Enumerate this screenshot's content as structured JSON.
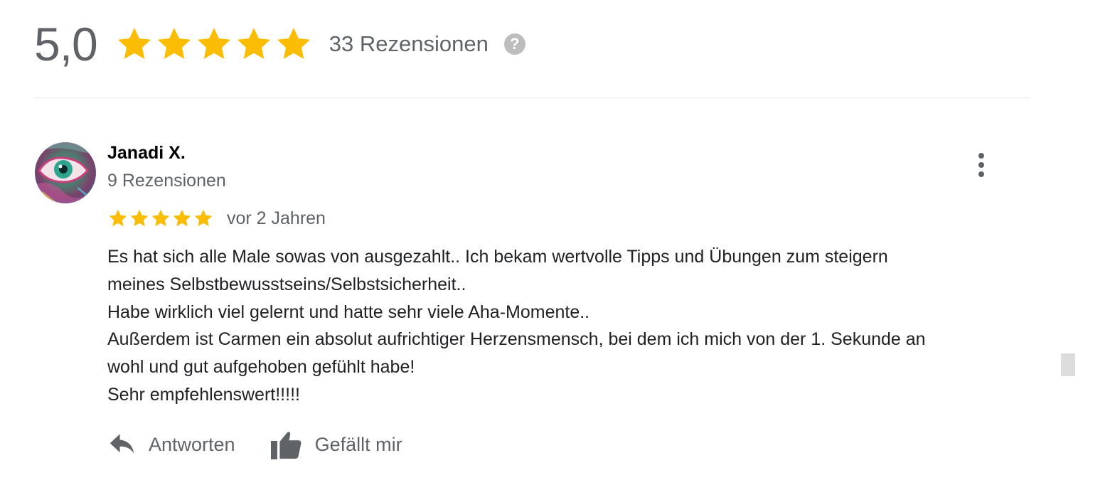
{
  "summary": {
    "average": "5,0",
    "stars": 5,
    "review_count": "33 Rezensionen",
    "help_icon": "question-circle-icon",
    "star_color": "#fbbc04"
  },
  "review": {
    "author": "Janadi X.",
    "author_reviews": "9 Rezensionen",
    "rating": 5,
    "date": "vor 2 Jahren",
    "lines": [
      "Es hat sich alle Male sowas von ausgezahlt..  Ich bekam wertvolle Tipps und Übungen zum steigern",
      "meines Selbstbewusstseins/Selbstsicherheit..",
      "Habe wirklich viel gelernt und hatte sehr viele Aha-Momente..",
      "Außerdem ist Carmen ein absolut aufrichtiger Herzensmensch, bei dem ich mich von der 1. Sekunde an",
      "wohl und gut aufgehoben gefühlt habe!",
      "Sehr empfehlenswert!!!!!"
    ],
    "more_icon": "more-vertical-icon"
  },
  "actions": {
    "reply_label": "Antworten",
    "reply_icon": "reply-icon",
    "like_label": "Gefällt mir",
    "like_icon": "thumbs-up-icon"
  }
}
